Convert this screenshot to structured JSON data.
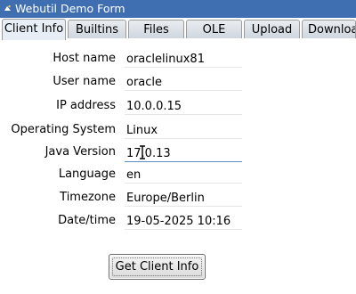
{
  "window": {
    "title": "Webutil Demo Form",
    "icon": "app-window-icon"
  },
  "tabs": [
    {
      "label": "Client Info",
      "active": true
    },
    {
      "label": "Builtins"
    },
    {
      "label": "Files"
    },
    {
      "label": "OLE"
    },
    {
      "label": "Upload"
    },
    {
      "label": "Downloa"
    }
  ],
  "fields": [
    {
      "label": "Host name",
      "value": "oraclelinux81"
    },
    {
      "label": "User name",
      "value": "oracle"
    },
    {
      "label": "IP address",
      "value": "10.0.0.15"
    },
    {
      "label": "Operating System",
      "value": "Linux"
    },
    {
      "label": "Java Version",
      "value": "17.0.13"
    },
    {
      "label": "Language",
      "value": "en"
    },
    {
      "label": "Timezone",
      "value": "Europe/Berlin"
    },
    {
      "label": "Date/time",
      "value": "19-05-2025 10:16"
    }
  ],
  "button": {
    "label": "Get Client Info"
  },
  "colors": {
    "titlebar": "#3f6fb1",
    "focus_underline": "#5f8fc0"
  }
}
